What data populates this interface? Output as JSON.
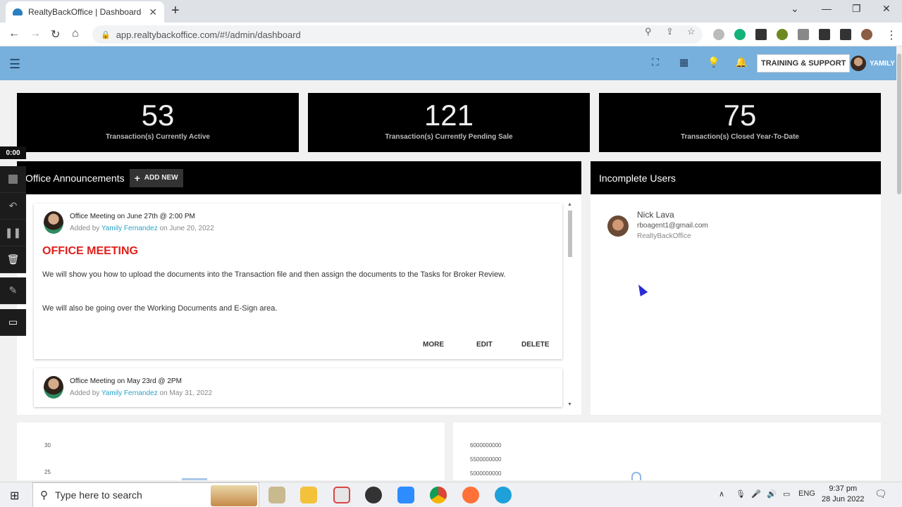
{
  "browser": {
    "tab_title": "RealtyBackOffice | Dashboard",
    "new_tab": "+",
    "url": "app.realtybackoffice.com/#!/admin/dashboard"
  },
  "header": {
    "training_label": "TRAINING & SUPPORT",
    "user_name": "YAMILY"
  },
  "stats": [
    {
      "value": "53",
      "label": "Transaction(s) Currently Active"
    },
    {
      "value": "121",
      "label": "Transaction(s) Currently Pending Sale"
    },
    {
      "value": "75",
      "label": "Transaction(s) Closed Year-To-Date"
    }
  ],
  "announcements": {
    "title": "Office Announcements",
    "add_new_label": "ADD NEW",
    "items": [
      {
        "title": "Office Meeting on June 27th @ 2:00 PM",
        "added_by_prefix": "Added by",
        "author": "Yamily Fernandez",
        "date_text": "on June 20, 2022",
        "heading": "OFFICE MEETING",
        "body1": "We will show you how to upload the documents into the Transaction file and then assign the documents to the Tasks for Broker Review.",
        "body2": "We will also be going over the Working Documents and E-Sign area.",
        "more": "MORE",
        "edit": "EDIT",
        "delete": "DELETE"
      },
      {
        "title": "Office Meeting on May 23rd @ 2PM",
        "added_by_prefix": "Added by",
        "author": "Yamily Fernandez",
        "date_text": "on May 31, 2022"
      }
    ]
  },
  "incomplete_users": {
    "title": "Incomplete Users",
    "users": [
      {
        "name": "Nick Lava",
        "email": "rboagent1@gmail.com",
        "org": "RealtyBackOffice"
      }
    ]
  },
  "charts": {
    "left_ticks": [
      "30",
      "25"
    ],
    "right_ticks": [
      "6000000000",
      "5500000000",
      "5000000000"
    ]
  },
  "recorder": {
    "time": "0:00"
  },
  "taskbar": {
    "search_placeholder": "Type here to search",
    "language": "ENG",
    "time": "9:37 pm",
    "date": "28 Jun 2022"
  },
  "colors": {
    "appbar": "#77b0dd",
    "heading_red": "#e0201b",
    "link": "#29a3c7"
  }
}
